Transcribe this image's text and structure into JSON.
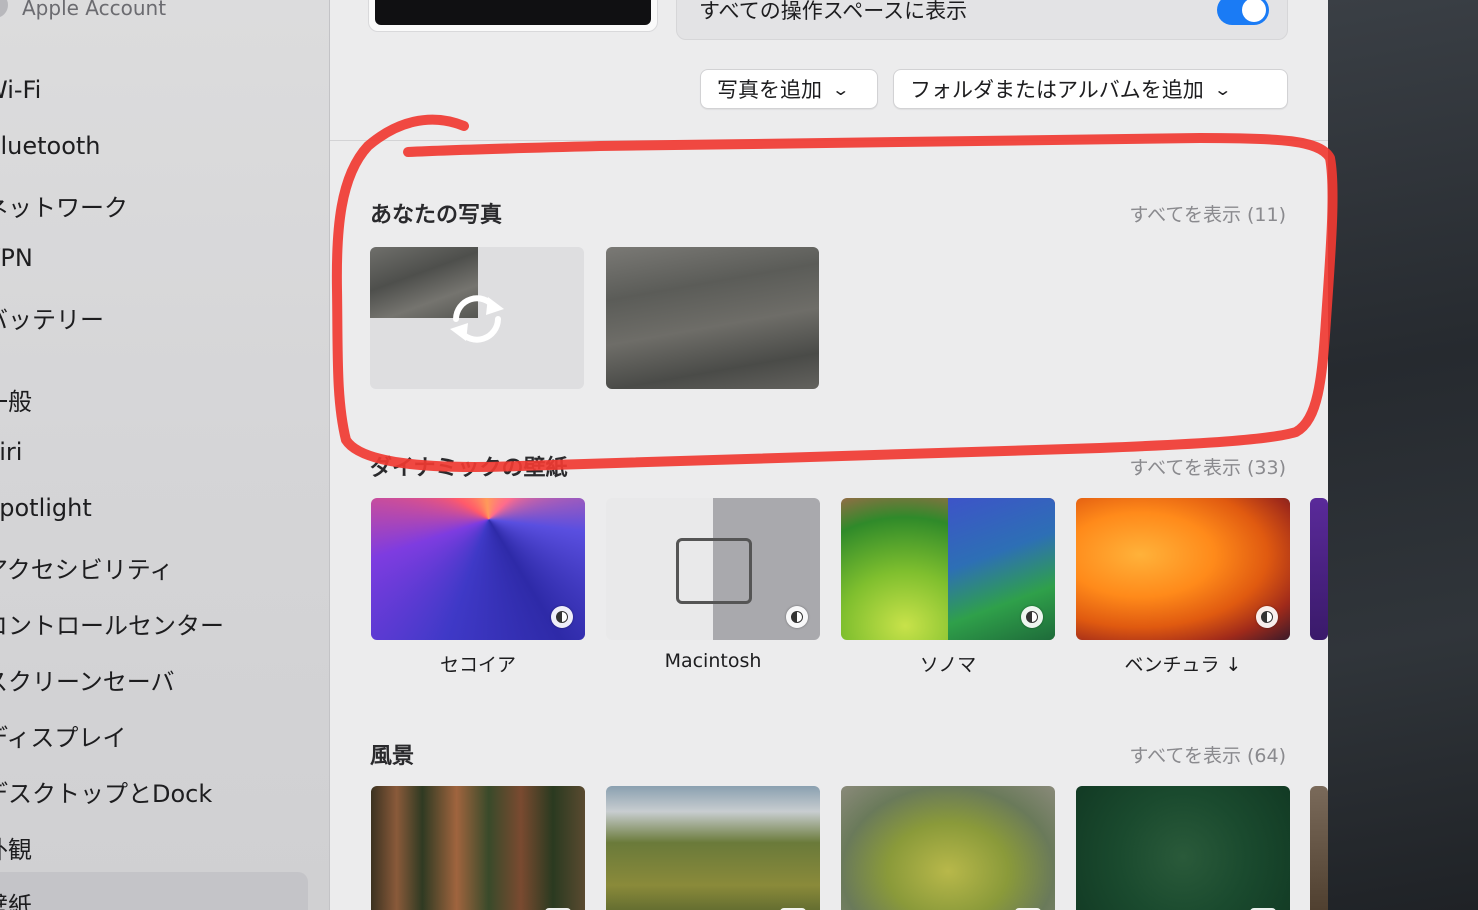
{
  "sidebar": {
    "account": "Apple Account",
    "items": [
      {
        "label": "Wi-Fi"
      },
      {
        "label": "Bluetooth"
      },
      {
        "label": "ネットワーク"
      },
      {
        "label": "VPN"
      },
      {
        "label": "バッテリー"
      },
      {
        "label": "一般"
      },
      {
        "label": "Siri"
      },
      {
        "label": "Spotlight"
      },
      {
        "label": "アクセシビリティ"
      },
      {
        "label": "コントロールセンター"
      },
      {
        "label": "スクリーンセーバ"
      },
      {
        "label": "ディスプレイ"
      },
      {
        "label": "デスクトップとDock"
      },
      {
        "label": "外観"
      },
      {
        "label": "壁紙"
      }
    ]
  },
  "header": {
    "show_all_spaces_label": "すべての操作スペースに表示",
    "show_all_spaces_on": true,
    "add_photo_label": "写真を追加",
    "add_folder_label": "フォルダまたはアルバムを追加"
  },
  "sections": {
    "your_photos": {
      "title": "あなたの写真",
      "link": "すべてを表示 (11)"
    },
    "dynamic": {
      "title": "ダイナミックの壁紙",
      "link": "すべてを表示 (33)",
      "items": [
        {
          "label": "セコイア"
        },
        {
          "label": "Macintosh"
        },
        {
          "label": "ソノマ"
        },
        {
          "label": "ベンチュラ ↓"
        }
      ]
    },
    "landscape": {
      "title": "風景",
      "link": "すべてを表示 (64)"
    }
  },
  "colors": {
    "accent": "#1a7bf5",
    "annotation": "#f03a32"
  },
  "icons": {
    "loading": "refresh-icon",
    "dynamic_badge": "dynamic-wallpaper-icon",
    "video_badge": "play-icon",
    "dropdown": "chevron-down-icon"
  }
}
